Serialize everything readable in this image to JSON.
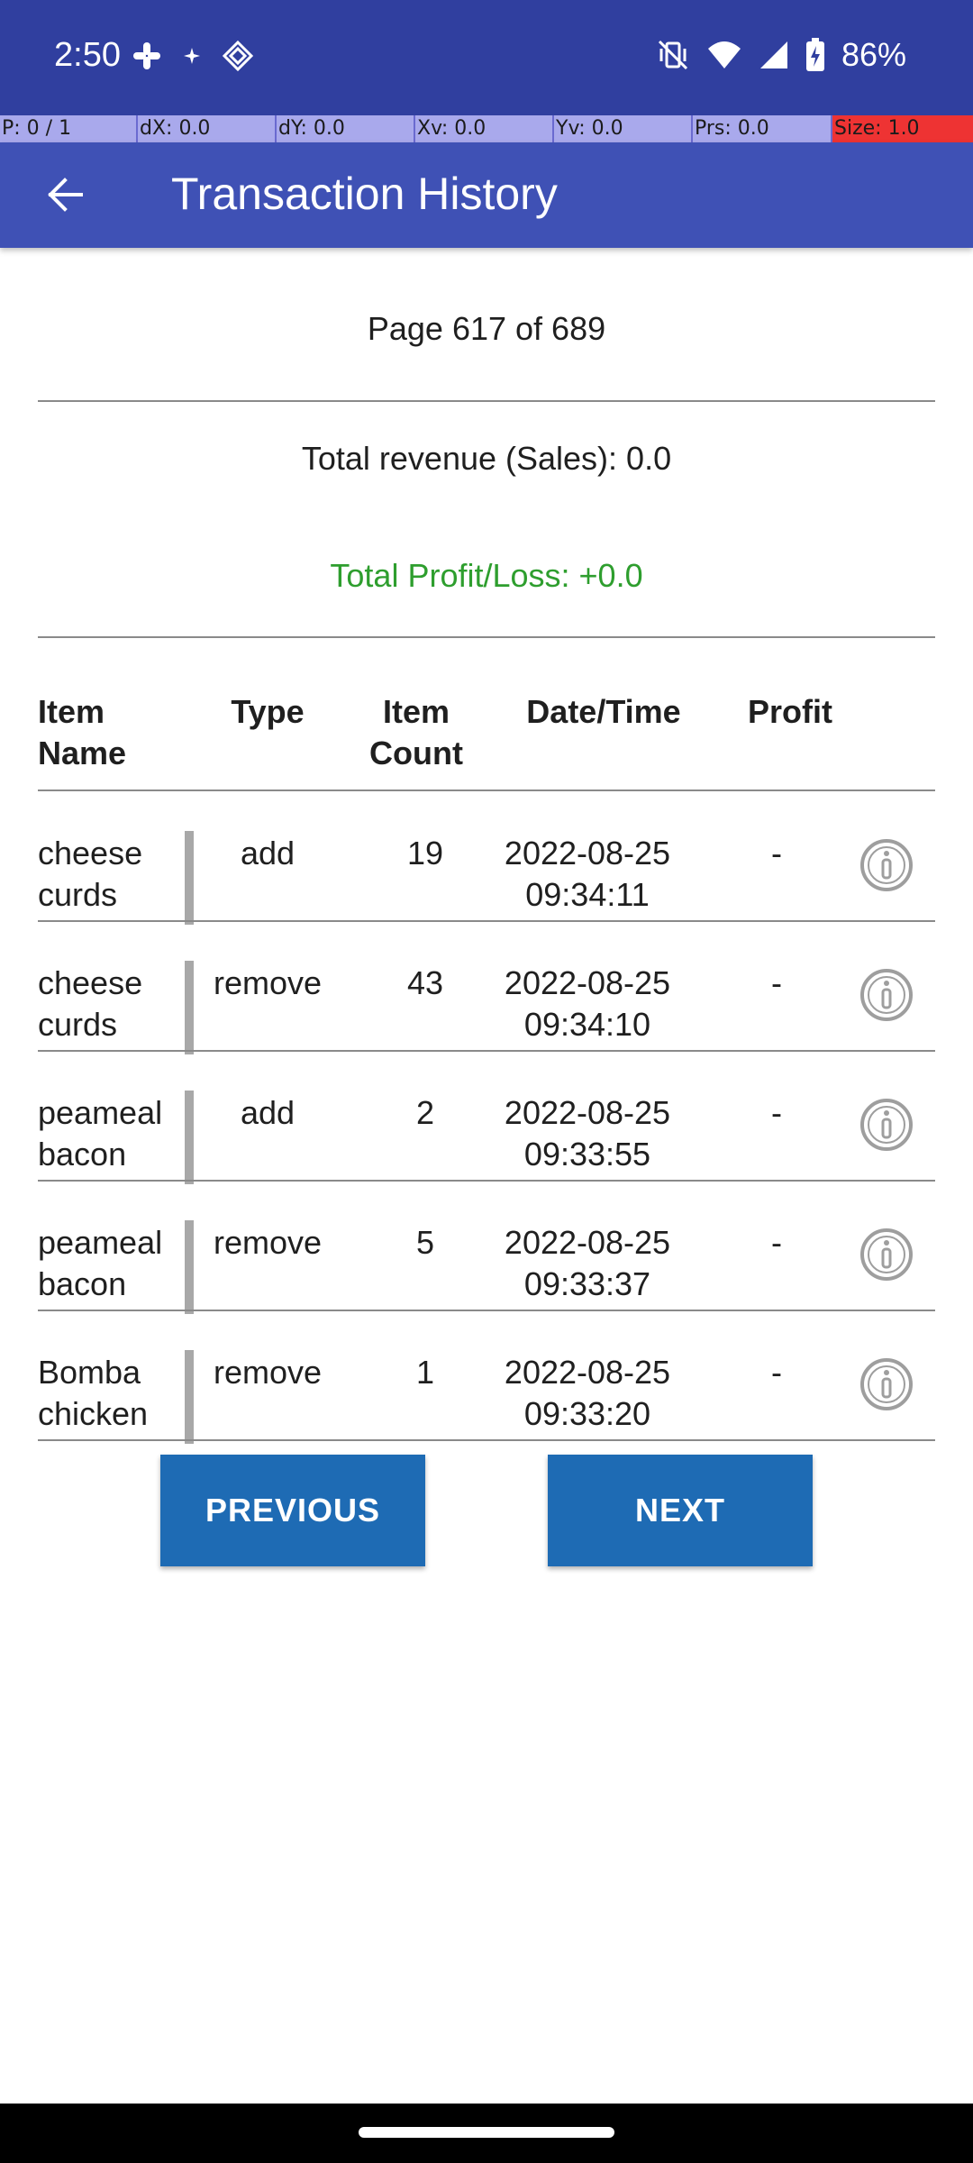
{
  "status_bar": {
    "time": "2:50",
    "battery": "86%",
    "left_icons": [
      "slack-icon",
      "sparkle-icon",
      "diamond-grid-icon"
    ],
    "right_icons": [
      "vibrate-off-icon",
      "wifi-icon",
      "signal-icon",
      "battery-charging-icon"
    ]
  },
  "pointer_overlay": {
    "p": "P: 0 / 1",
    "dx": "dX: 0.0",
    "dy": "dY: 0.0",
    "xv": "Xv: 0.0",
    "yv": "Yv: 0.0",
    "prs": "Prs: 0.0",
    "size": "Size: 1.0"
  },
  "app_bar": {
    "title": "Transaction History",
    "back_icon": "arrow-back-icon"
  },
  "summary": {
    "page": "Page 617 of 689",
    "revenue": "Total revenue (Sales): 0.0",
    "profit_loss": "Total Profit/Loss: +0.0",
    "profit_color": "#2e9e2e"
  },
  "table": {
    "headers": {
      "item_name": "Item\nName",
      "type": "Type",
      "item_count": "Item\nCount",
      "datetime": "Date/Time",
      "profit": "Profit"
    },
    "rows": [
      {
        "name": "cheese\ncurds",
        "type": "add",
        "count": "19",
        "datetime": "2022-08-25\n09:34:11",
        "profit": "-"
      },
      {
        "name": "cheese\ncurds",
        "type": "remove",
        "count": "43",
        "datetime": "2022-08-25\n09:34:10",
        "profit": "-"
      },
      {
        "name": "peameal\nbacon",
        "type": "add",
        "count": "2",
        "datetime": "2022-08-25\n09:33:55",
        "profit": "-"
      },
      {
        "name": "peameal\nbacon",
        "type": "remove",
        "count": "5",
        "datetime": "2022-08-25\n09:33:37",
        "profit": "-"
      },
      {
        "name": "Bomba\nchicken",
        "type": "remove",
        "count": "1",
        "datetime": "2022-08-25\n09:33:20",
        "profit": "-"
      }
    ]
  },
  "buttons": {
    "previous": "PREVIOUS",
    "next": "NEXT",
    "color": "#1e6bb4"
  },
  "theme": {
    "status_bar": "#303f9f",
    "app_bar": "#3f51b5"
  }
}
